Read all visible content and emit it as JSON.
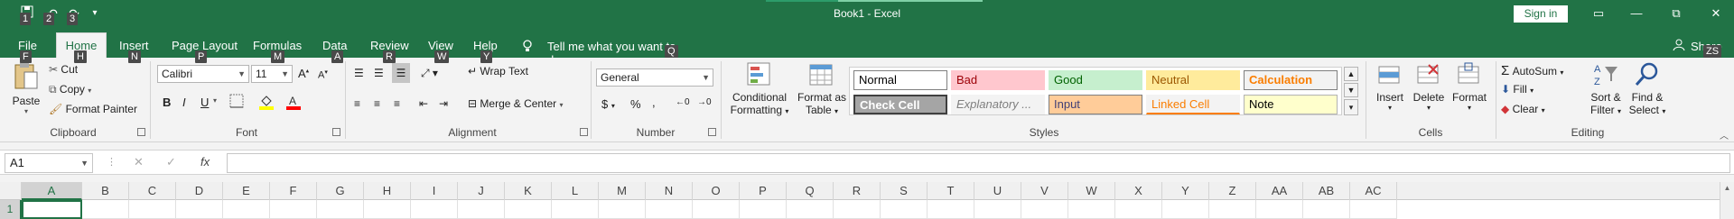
{
  "window": {
    "title": "Book1  -  Excel",
    "signin_label": "Sign in",
    "minimize_label": "—",
    "restore_label": "⧉",
    "close_label": "✕",
    "ribbon_display_label": "▭"
  },
  "qat": {
    "keytips": [
      "1",
      "2",
      "3"
    ]
  },
  "tabs": [
    {
      "label": "File",
      "keytip": "F"
    },
    {
      "label": "Home",
      "keytip": "H"
    },
    {
      "label": "Insert",
      "keytip": "N"
    },
    {
      "label": "Page Layout",
      "keytip": "P"
    },
    {
      "label": "Formulas",
      "keytip": "M"
    },
    {
      "label": "Data",
      "keytip": "A"
    },
    {
      "label": "Review",
      "keytip": "R"
    },
    {
      "label": "View",
      "keytip": "W"
    },
    {
      "label": "Help",
      "keytip": "Y"
    }
  ],
  "tellme": {
    "label": "Tell me what you want to do",
    "keytip": "Q"
  },
  "share": {
    "label": "Share",
    "keytip": "ZS"
  },
  "ribbon": {
    "clipboard": {
      "label": "Clipboard",
      "paste": "Paste",
      "cut": "Cut",
      "copy": "Copy",
      "format_painter": "Format Painter"
    },
    "font": {
      "label": "Font",
      "font_name": "Calibri",
      "font_size": "11"
    },
    "alignment": {
      "label": "Alignment",
      "wrap_text": "Wrap Text",
      "merge_center": "Merge & Center"
    },
    "number": {
      "label": "Number",
      "format": "General"
    },
    "styles": {
      "label": "Styles",
      "conditional_formatting": [
        "Conditional",
        "Formatting"
      ],
      "format_as_table": [
        "Format as",
        "Table"
      ],
      "cells": [
        {
          "label": "Normal",
          "bg": "#ffffff",
          "fg": "#000000",
          "border": "#7f7f7f"
        },
        {
          "label": "Bad",
          "bg": "#ffc7ce",
          "fg": "#9c0006",
          "border": "#ffc7ce"
        },
        {
          "label": "Good",
          "bg": "#c6efce",
          "fg": "#006100",
          "border": "#c6efce"
        },
        {
          "label": "Neutral",
          "bg": "#ffeb9c",
          "fg": "#9c5700",
          "border": "#ffeb9c"
        },
        {
          "label": "Calculation",
          "bg": "#f2f2f2",
          "fg": "#fa7d00",
          "border": "#7f7f7f"
        },
        {
          "label": "Check Cell",
          "bg": "#a5a5a5",
          "fg": "#ffffff",
          "border": "#3f3f3f"
        },
        {
          "label": "Explanatory ...",
          "bg": "#f3f3f3",
          "fg": "#7f7f7f",
          "border": "#f3f3f3"
        },
        {
          "label": "Input",
          "bg": "#ffcc99",
          "fg": "#3f3f76",
          "border": "#7f7f7f"
        },
        {
          "label": "Linked Cell",
          "bg": "#f3f3f3",
          "fg": "#fa7d00",
          "border": "#f3f3f3"
        },
        {
          "label": "Note",
          "bg": "#ffffcc",
          "fg": "#000000",
          "border": "#b2b2b2"
        }
      ]
    },
    "cells": {
      "label": "Cells",
      "insert": "Insert",
      "delete": "Delete",
      "format": "Format"
    },
    "editing": {
      "label": "Editing",
      "autosum": "AutoSum",
      "fill": "Fill",
      "clear": "Clear",
      "sort_filter": [
        "Sort &",
        "Filter"
      ],
      "find_select": [
        "Find &",
        "Select"
      ]
    }
  },
  "formula_bar": {
    "name_box": "A1",
    "cancel": "✕",
    "enter": "✓",
    "fx": "fx",
    "formula": ""
  },
  "grid": {
    "columns": [
      "A",
      "B",
      "C",
      "D",
      "E",
      "F",
      "G",
      "H",
      "I",
      "J",
      "K",
      "L",
      "M",
      "N",
      "O",
      "P",
      "Q",
      "R",
      "S",
      "T",
      "U",
      "V",
      "W",
      "X",
      "Y",
      "Z",
      "AA",
      "AB",
      "AC"
    ],
    "rows": [
      "1"
    ],
    "active_cell": "A1"
  },
  "colors": {
    "accent": "#217346",
    "ribbon_bg": "#f3f3f3",
    "font_color_red": "#ff0000",
    "highlight_yellow": "#ffff00"
  }
}
